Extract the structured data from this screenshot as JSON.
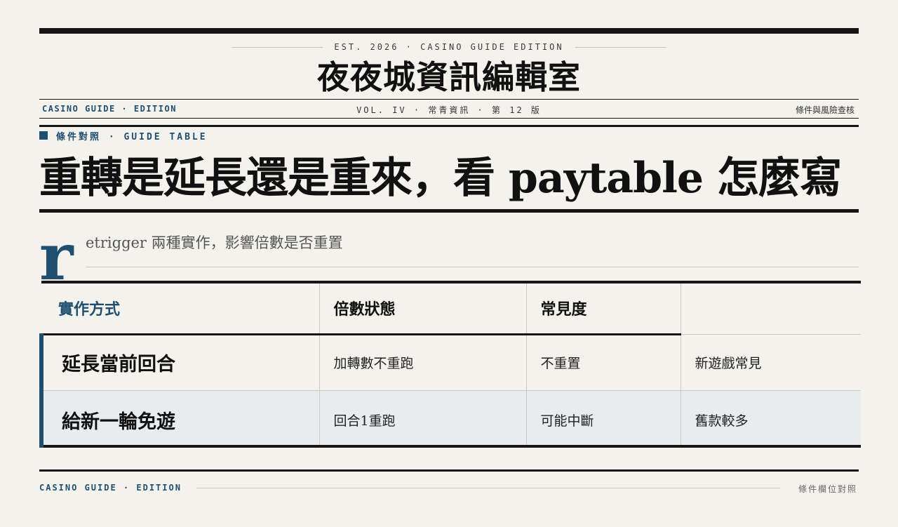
{
  "masthead": {
    "est": "EST. 2026 · CASINO GUIDE EDITION",
    "title": "夜夜城資訊編輯室"
  },
  "subhead": {
    "left": "CASINO GUIDE · EDITION",
    "center": "VOL. IV · 常青資訊 · 第 12 版",
    "right": "條件與風險查核"
  },
  "article": {
    "kicker": "條件對照 · GUIDE TABLE",
    "headline": "重轉是延長還是重來，看 paytable 怎麼寫",
    "dropcap": "r",
    "deck": "etrigger 兩種實作，影響倍數是否重置"
  },
  "table": {
    "headers": [
      "實作方式",
      "倍數狀態",
      "常見度"
    ],
    "rows": [
      [
        "延長當前回合",
        "加轉數不重跑",
        "不重置",
        "新遊戲常見"
      ],
      [
        "給新一輪免遊",
        "回合1重跑",
        "可能中斷",
        "舊款較多"
      ]
    ]
  },
  "footer": {
    "left": "CASINO GUIDE · EDITION",
    "right": "條件欄位對照"
  },
  "colors": {
    "accent": "#1f4e6f",
    "ink": "#161616",
    "paper": "#f4f2ed",
    "row_alt": "#e8ecef"
  }
}
